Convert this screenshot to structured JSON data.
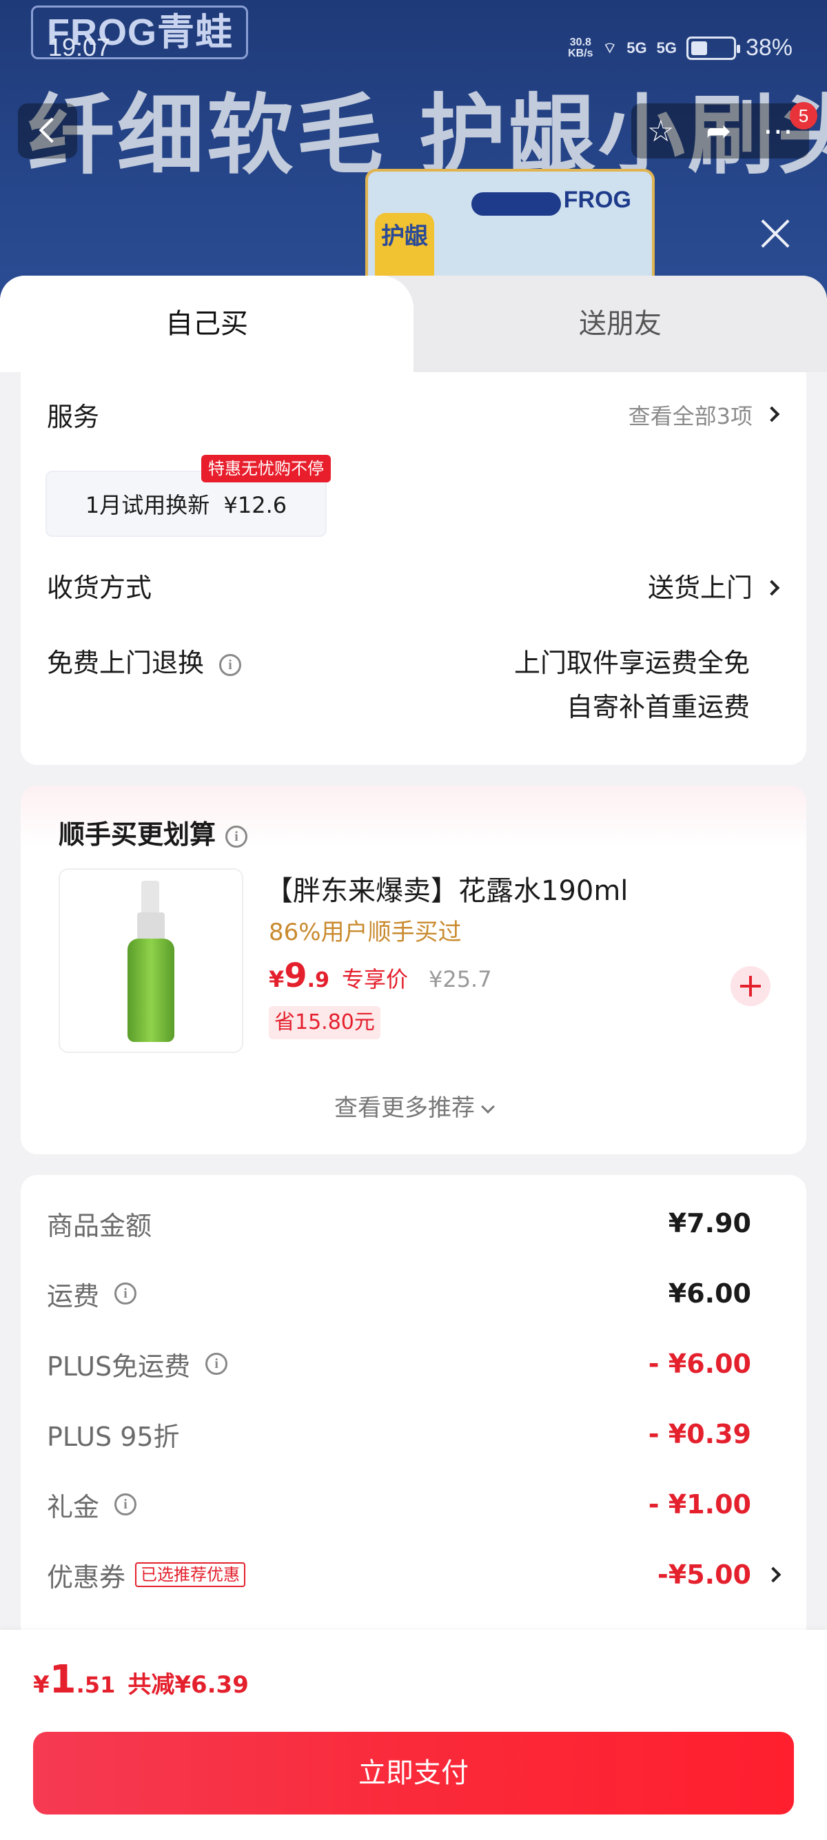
{
  "status_bar": {
    "time": "19:07",
    "net_speed_value": "30.8",
    "net_speed_unit": "KB/s",
    "signal1": "5G",
    "signal2": "5G",
    "battery_pct": "38%",
    "battery_level": 0.38
  },
  "banner": {
    "brand": "FROG青蛙",
    "headline": "纤细软毛 护龈小刷头",
    "pack_brand": "FROG",
    "pack_label": "护龈",
    "badge_count": "5"
  },
  "tabs": [
    {
      "label": "自己买",
      "active": true
    },
    {
      "label": "送朋友",
      "active": false
    }
  ],
  "service": {
    "title": "服务",
    "view_all": "查看全部3项",
    "chip_label": "1月试用换新",
    "chip_price": "¥12.6",
    "chip_tag": "特惠无忧购不停"
  },
  "delivery": {
    "title": "收货方式",
    "value": "送货上门"
  },
  "free_return": {
    "title": "免费上门退换",
    "line1": "上门取件享运费全免",
    "line2": "自寄补首重运费"
  },
  "addon": {
    "title": "顺手买更划算",
    "product_name": "【胖东来爆卖】花露水190ml",
    "buyers_note": "86%用户顺手买过",
    "price_currency": "¥",
    "price_int": "9",
    "price_dec": ".9",
    "exclusive_label": "专享价",
    "original_price": "¥25.7",
    "save_label": "省15.80元",
    "more_label": "查看更多推荐"
  },
  "fees": [
    {
      "label": "商品金额",
      "value": "¥7.90",
      "red": false,
      "info": false
    },
    {
      "label": "运费",
      "value": "¥6.00",
      "red": false,
      "info": true
    },
    {
      "label": "PLUS免运费",
      "value": "- ¥6.00",
      "red": true,
      "info": true
    },
    {
      "label": "PLUS 95折",
      "value": "- ¥0.39",
      "red": true,
      "info": false
    },
    {
      "label": "礼金",
      "value": "- ¥1.00",
      "red": true,
      "info": true
    },
    {
      "label": "优惠券",
      "value": "-¥5.00",
      "red": true,
      "info": false,
      "tag": "已选推荐优惠"
    }
  ],
  "footer": {
    "currency": "¥",
    "total_int": "1",
    "total_dec": ".51",
    "reduce_label": "共减¥6.39",
    "pay_label": "立即支付"
  },
  "colors": {
    "accent_red": "#e4202d",
    "banner_blue": "#27478c"
  }
}
